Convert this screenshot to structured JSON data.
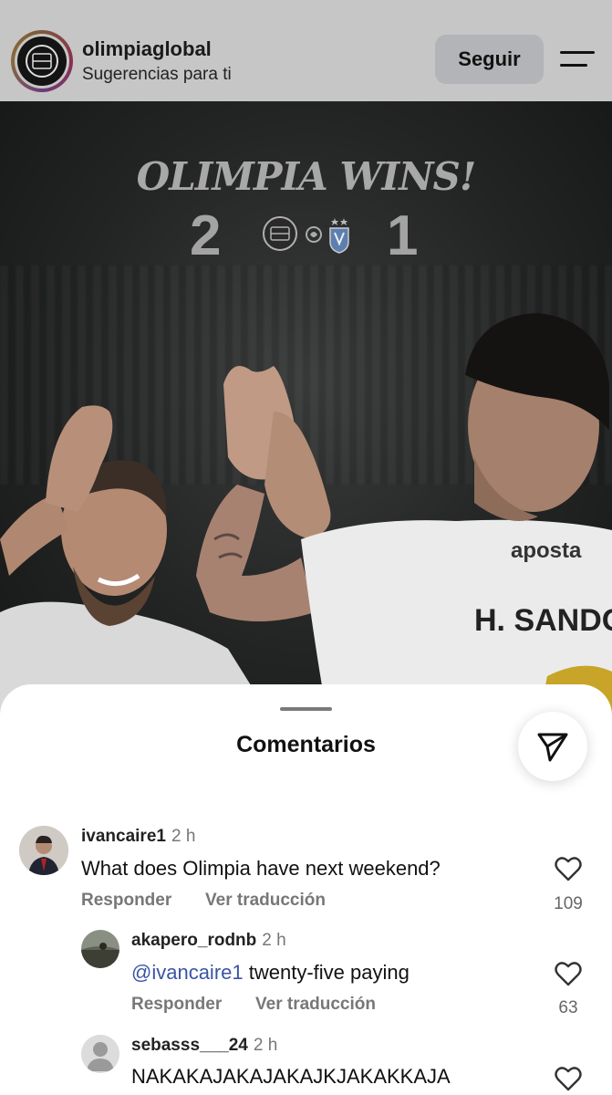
{
  "header": {
    "username": "olimpiaglobal",
    "subtitle": "Sugerencias para ti",
    "follow_label": "Seguir"
  },
  "post": {
    "headline": "OLIMPIA WINS!",
    "home_score": "2",
    "away_score": "1",
    "jersey_sponsor": "aposta",
    "jersey_name": "H. SANDO"
  },
  "comments_sheet": {
    "title": "Comentarios",
    "comments": [
      {
        "username": "ivancaire1",
        "time": "2 h",
        "text": "What does Olimpia have next weekend?",
        "reply_label": "Responder",
        "translate_label": "Ver traducción",
        "likes": "109"
      },
      {
        "username": "akapero_rodnb",
        "time": "2 h",
        "mention": "@ivancaire1",
        "text": " twenty-five paying",
        "reply_label": "Responder",
        "translate_label": "Ver traducción",
        "likes": "63"
      },
      {
        "username": "sebasss___24",
        "time": "2 h",
        "text": "NAKAKAJAKAJAKAJKJAKAKKAJA"
      }
    ]
  },
  "colors": {
    "mention": "#3a55a6",
    "sheet_background": "#ffffff",
    "dim_overlay": "#c6c6c6"
  },
  "icons": [
    "menu-icon",
    "paper-plane-icon",
    "heart-icon",
    "default-avatar-icon"
  ]
}
